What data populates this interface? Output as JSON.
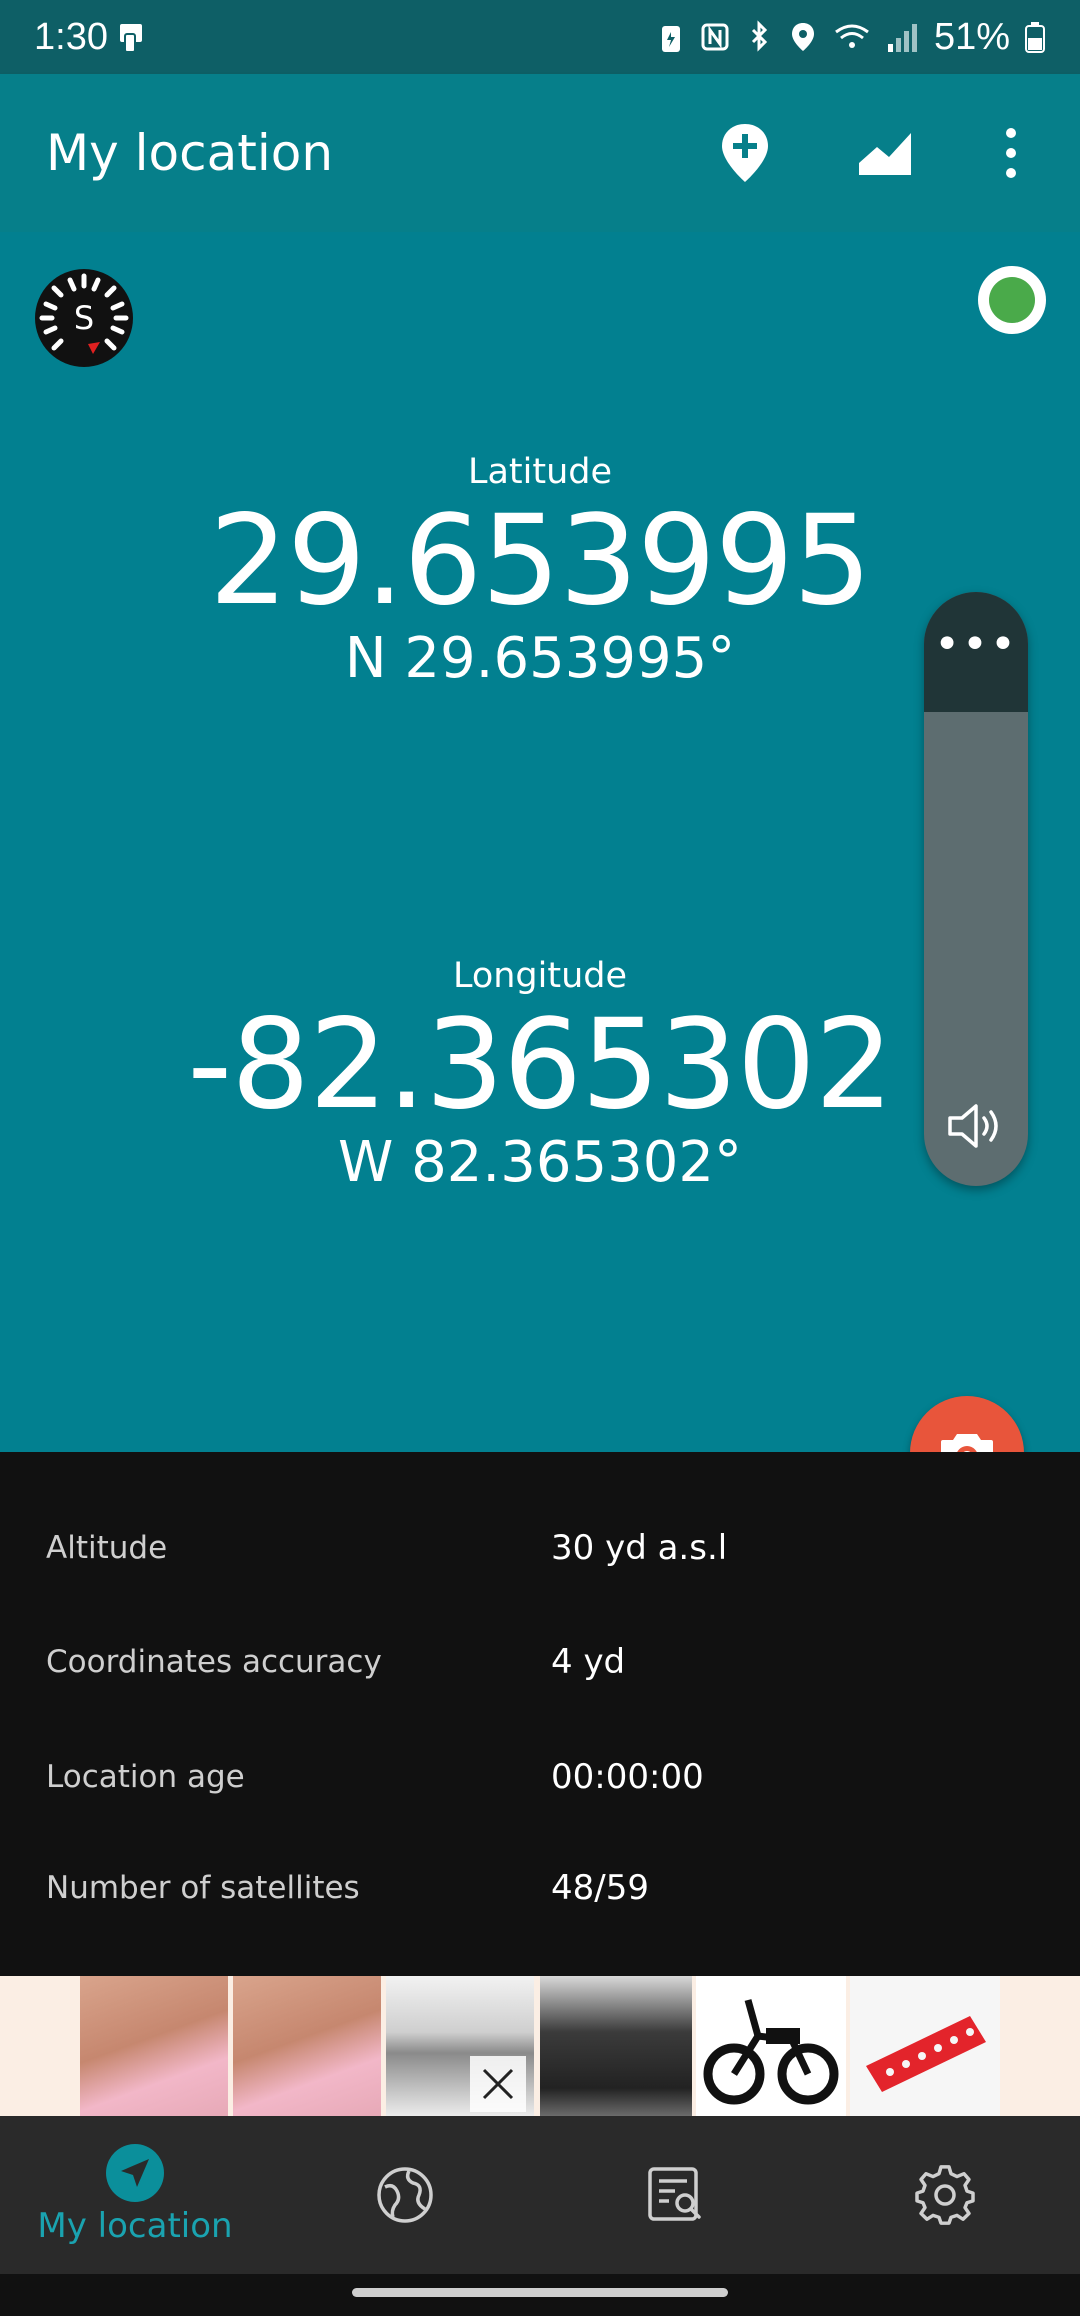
{
  "status_bar": {
    "time": "1:30",
    "battery": "51%"
  },
  "app_bar": {
    "title": "My location",
    "icons": [
      "add-location-icon",
      "elevation-chart-icon",
      "more-vert-icon"
    ]
  },
  "main": {
    "latitude": {
      "label": "Latitude",
      "value": "29.653995",
      "dms": "N 29.653995°"
    },
    "longitude": {
      "label": "Longitude",
      "value": "-82.365302",
      "dms": "W 82.365302°"
    },
    "gps_status_color": "#4aaa4a"
  },
  "info": [
    {
      "key": "Altitude",
      "value": "30 yd a.s.l"
    },
    {
      "key": "Coordinates accuracy",
      "value": "4 yd"
    },
    {
      "key": "Location age",
      "value": "00:00:00"
    },
    {
      "key": "Number of satellites",
      "value": "48/59"
    }
  ],
  "nav": {
    "items": [
      {
        "label": "My location",
        "icon": "navigation-arrow-icon",
        "active": true
      },
      {
        "label": "",
        "icon": "globe-icon",
        "active": false
      },
      {
        "label": "",
        "icon": "list-search-icon",
        "active": false
      },
      {
        "label": "",
        "icon": "gear-icon",
        "active": false
      }
    ]
  },
  "colors": {
    "teal": "#028090",
    "appbar": "#067f8a",
    "fab": "#e8553b",
    "accent": "#1aa3b0"
  }
}
